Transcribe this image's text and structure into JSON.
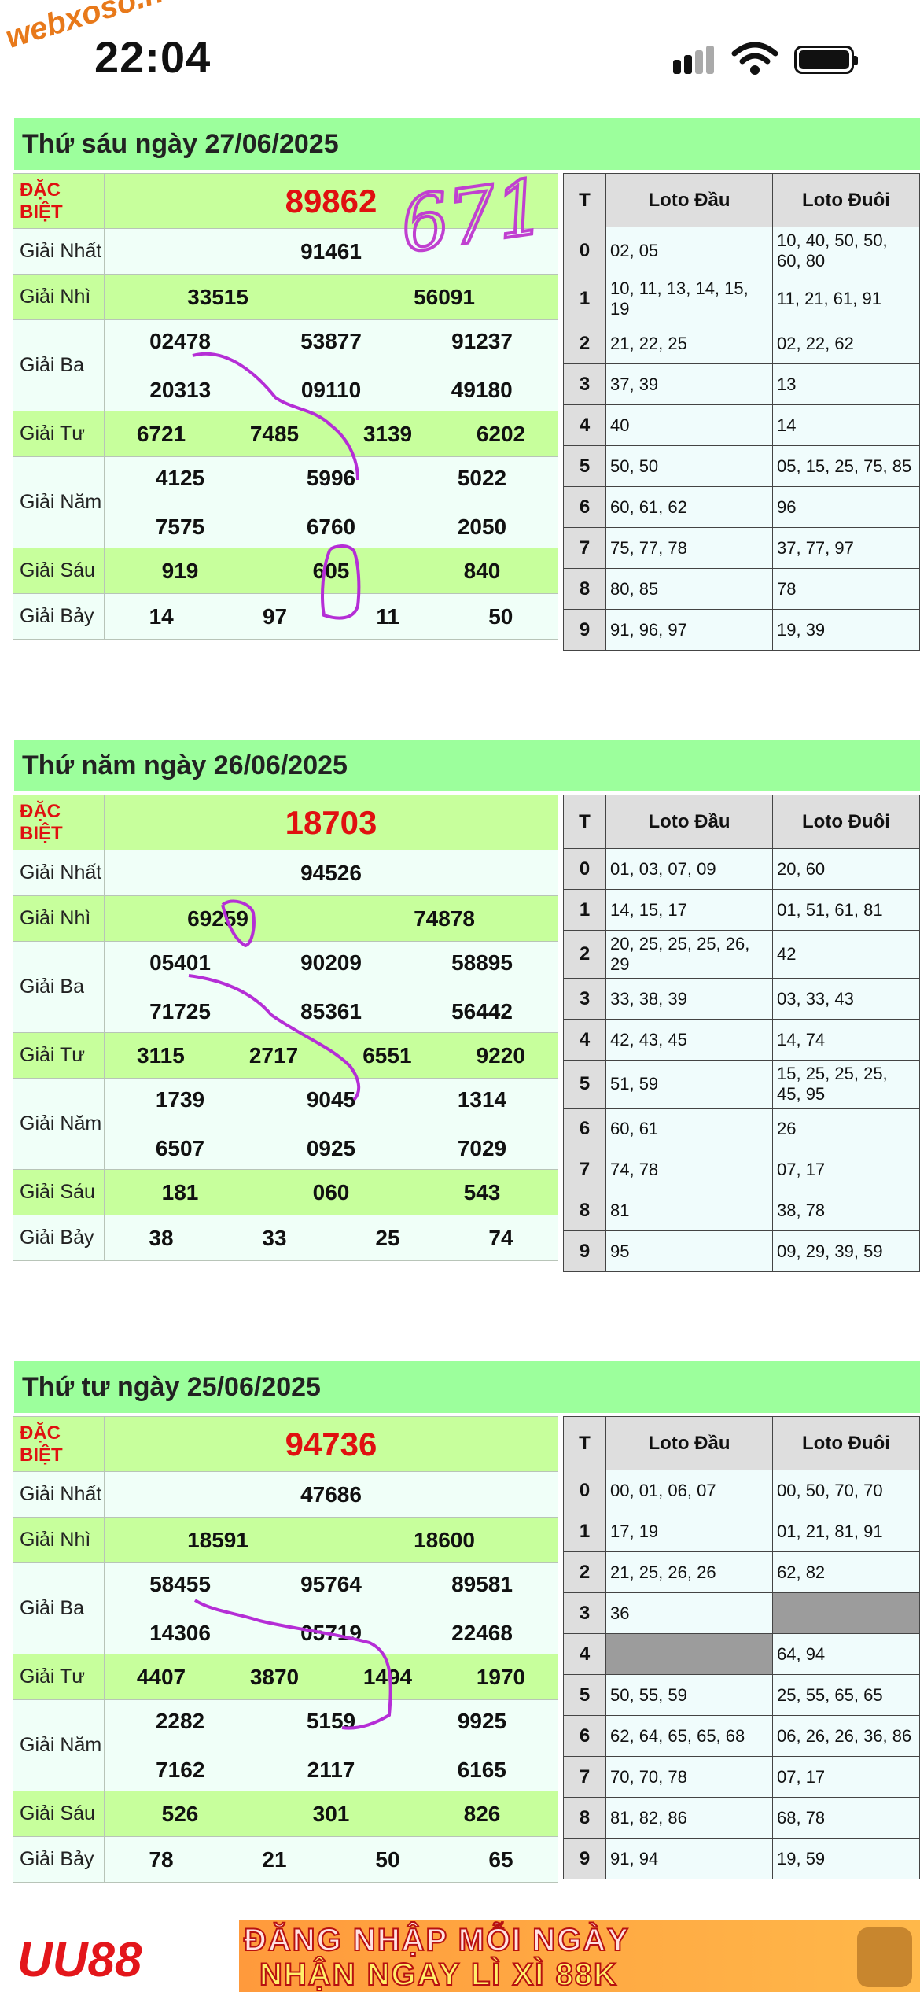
{
  "status_bar": {
    "time": "22:04",
    "watermark": "webxoso.net"
  },
  "annotation": {
    "handwritten_number": "671"
  },
  "loto_headers": {
    "t": "T",
    "dau": "Loto Đầu",
    "duoi": "Loto Đuôi"
  },
  "labels": {
    "db": "ĐẶC BIỆT",
    "g1": "Giải Nhất",
    "g2": "Giải Nhì",
    "g3": "Giải Ba",
    "g4": "Giải Tư",
    "g5": "Giải Năm",
    "g6": "Giải Sáu",
    "g7": "Giải Bảy"
  },
  "days": [
    {
      "title": "Thứ sáu ngày 27/06/2025",
      "db": "89862",
      "g1": "91461",
      "g2": [
        "33515",
        "56091"
      ],
      "g3": [
        "02478",
        "53877",
        "91237",
        "20313",
        "09110",
        "49180"
      ],
      "g4": [
        "6721",
        "7485",
        "3139",
        "6202"
      ],
      "g5": [
        "4125",
        "5996",
        "5022",
        "7575",
        "6760",
        "2050"
      ],
      "g6": [
        "919",
        "605",
        "840"
      ],
      "g7": [
        "14",
        "97",
        "11",
        "50"
      ],
      "loto": [
        {
          "t": "0",
          "dau": "02, 05",
          "duoi": "10, 40, 50, 50, 60, 80"
        },
        {
          "t": "1",
          "dau": "10, 11, 13, 14, 15, 19",
          "duoi": "11, 21, 61, 91"
        },
        {
          "t": "2",
          "dau": "21, 22, 25",
          "duoi": "02, 22, 62"
        },
        {
          "t": "3",
          "dau": "37, 39",
          "duoi": "13"
        },
        {
          "t": "4",
          "dau": "40",
          "duoi": "14"
        },
        {
          "t": "5",
          "dau": "50, 50",
          "duoi": "05, 15, 25, 75, 85"
        },
        {
          "t": "6",
          "dau": "60, 61, 62",
          "duoi": "96"
        },
        {
          "t": "7",
          "dau": "75, 77, 78",
          "duoi": "37, 77, 97"
        },
        {
          "t": "8",
          "dau": "80, 85",
          "duoi": "78"
        },
        {
          "t": "9",
          "dau": "91, 96, 97",
          "duoi": "19, 39"
        }
      ]
    },
    {
      "title": "Thứ năm ngày 26/06/2025",
      "db": "18703",
      "g1": "94526",
      "g2": [
        "69259",
        "74878"
      ],
      "g3": [
        "05401",
        "90209",
        "58895",
        "71725",
        "85361",
        "56442"
      ],
      "g4": [
        "3115",
        "2717",
        "6551",
        "9220"
      ],
      "g5": [
        "1739",
        "9045",
        "1314",
        "6507",
        "0925",
        "7029"
      ],
      "g6": [
        "181",
        "060",
        "543"
      ],
      "g7": [
        "38",
        "33",
        "25",
        "74"
      ],
      "loto": [
        {
          "t": "0",
          "dau": "01, 03, 07, 09",
          "duoi": "20, 60"
        },
        {
          "t": "1",
          "dau": "14, 15, 17",
          "duoi": "01, 51, 61, 81"
        },
        {
          "t": "2",
          "dau": "20, 25, 25, 25, 26, 29",
          "duoi": "42"
        },
        {
          "t": "3",
          "dau": "33, 38, 39",
          "duoi": "03, 33, 43"
        },
        {
          "t": "4",
          "dau": "42, 43, 45",
          "duoi": "14, 74"
        },
        {
          "t": "5",
          "dau": "51, 59",
          "duoi": "15, 25, 25, 25, 45, 95"
        },
        {
          "t": "6",
          "dau": "60, 61",
          "duoi": "26"
        },
        {
          "t": "7",
          "dau": "74, 78",
          "duoi": "07, 17"
        },
        {
          "t": "8",
          "dau": "81",
          "duoi": "38, 78"
        },
        {
          "t": "9",
          "dau": "95",
          "duoi": "09, 29, 39, 59"
        }
      ]
    },
    {
      "title": "Thứ tư ngày 25/06/2025",
      "db": "94736",
      "g1": "47686",
      "g2": [
        "18591",
        "18600"
      ],
      "g3": [
        "58455",
        "95764",
        "89581",
        "14306",
        "05719",
        "22468"
      ],
      "g4": [
        "4407",
        "3870",
        "1494",
        "1970"
      ],
      "g5": [
        "2282",
        "5159",
        "9925",
        "7162",
        "2117",
        "6165"
      ],
      "g6": [
        "526",
        "301",
        "826"
      ],
      "g7": [
        "78",
        "21",
        "50",
        "65"
      ],
      "loto": [
        {
          "t": "0",
          "dau": "00, 01, 06, 07",
          "duoi": "00, 50, 70, 70"
        },
        {
          "t": "1",
          "dau": "17, 19",
          "duoi": "01, 21, 81, 91"
        },
        {
          "t": "2",
          "dau": "21, 25, 26, 26",
          "duoi": "62, 82"
        },
        {
          "t": "3",
          "dau": "36",
          "duoi": ""
        },
        {
          "t": "4",
          "dau": "",
          "duoi": "64, 94"
        },
        {
          "t": "5",
          "dau": "50, 55, 59",
          "duoi": "25, 55, 65, 65"
        },
        {
          "t": "6",
          "dau": "62, 64, 65, 65, 68",
          "duoi": "06, 26, 26, 36, 86"
        },
        {
          "t": "7",
          "dau": "70, 70, 78",
          "duoi": "07, 17"
        },
        {
          "t": "8",
          "dau": "81, 82, 86",
          "duoi": "68, 78"
        },
        {
          "t": "9",
          "dau": "91, 94",
          "duoi": "19, 59"
        }
      ]
    }
  ],
  "banner": {
    "logo": "UU88",
    "line1": "ĐĂNG NHẬP MỖI NGÀY",
    "line2": "NHẬN NGAY LÌ XÌ 88K"
  }
}
